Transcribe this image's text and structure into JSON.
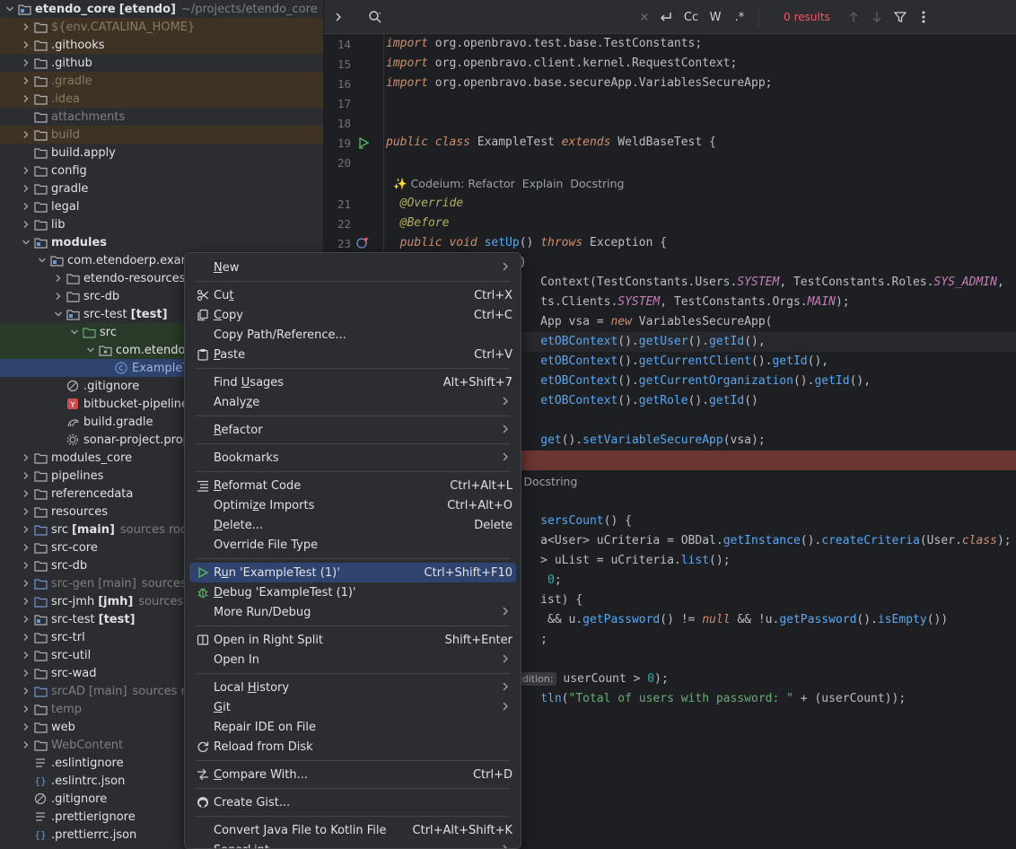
{
  "tree": {
    "items": [
      {
        "name": "etendo_core",
        "suffix": "[etendo]",
        "extra": "~/projects/etendo_core",
        "depth": 0,
        "expanded": true,
        "icon": "module-folder-icon",
        "style": "bold"
      },
      {
        "name": "${env.CATALINA_HOME}",
        "depth": 1,
        "expanded": false,
        "icon": "folder-icon",
        "style": "excl",
        "row": "hl-ex"
      },
      {
        "name": ".githooks",
        "depth": 1,
        "expanded": false,
        "icon": "folder-icon",
        "style": "normal",
        "row": "hl-ex"
      },
      {
        "name": ".github",
        "depth": 1,
        "expanded": false,
        "icon": "folder-icon",
        "style": "normal"
      },
      {
        "name": ".gradle",
        "depth": 1,
        "expanded": false,
        "icon": "folder-icon",
        "style": "excl",
        "row": "hl-ex"
      },
      {
        "name": ".idea",
        "depth": 1,
        "expanded": false,
        "icon": "folder-icon",
        "style": "excl",
        "row": "hl-ex"
      },
      {
        "name": "attachments",
        "depth": 1,
        "leaf": true,
        "icon": "folder-icon",
        "style": "dim"
      },
      {
        "name": "build",
        "depth": 1,
        "expanded": false,
        "icon": "folder-icon",
        "style": "excl",
        "row": "hl-ex"
      },
      {
        "name": "build.apply",
        "depth": 1,
        "leaf": true,
        "icon": "folder-icon",
        "style": "normal"
      },
      {
        "name": "config",
        "depth": 1,
        "expanded": false,
        "icon": "folder-icon",
        "style": "normal"
      },
      {
        "name": "gradle",
        "depth": 1,
        "expanded": false,
        "icon": "folder-icon",
        "style": "normal"
      },
      {
        "name": "legal",
        "depth": 1,
        "expanded": false,
        "icon": "folder-icon",
        "style": "normal"
      },
      {
        "name": "lib",
        "depth": 1,
        "expanded": false,
        "icon": "folder-icon",
        "style": "normal"
      },
      {
        "name": "modules",
        "depth": 1,
        "expanded": true,
        "icon": "module-folder-icon",
        "style": "bold"
      },
      {
        "name": "com.etendoerp.exam",
        "depth": 2,
        "expanded": true,
        "icon": "module-folder-icon",
        "style": "normal"
      },
      {
        "name": "etendo-resources",
        "depth": 3,
        "expanded": false,
        "icon": "folder-icon",
        "style": "normal"
      },
      {
        "name": "src-db",
        "depth": 3,
        "expanded": false,
        "icon": "folder-icon",
        "style": "normal"
      },
      {
        "name": "src-test",
        "suffix": "[test]",
        "depth": 3,
        "expanded": true,
        "icon": "module-folder-icon",
        "style": "normal"
      },
      {
        "name": "src",
        "depth": 4,
        "expanded": true,
        "icon": "test-folder-icon",
        "style": "normal",
        "row": "hl-src"
      },
      {
        "name": "com.etendoe",
        "depth": 5,
        "expanded": true,
        "icon": "package-icon",
        "style": "normal",
        "row": "hl-src"
      },
      {
        "name": "ExampleT",
        "depth": 6,
        "leaf": true,
        "icon": "java-class-icon",
        "style": "cls",
        "row": "sel"
      },
      {
        "name": ".gitignore",
        "depth": 3,
        "leaf": true,
        "icon": "ignore-file-icon",
        "style": "normal"
      },
      {
        "name": "bitbucket-pipeline",
        "depth": 3,
        "leaf": true,
        "icon": "yaml-file-icon",
        "style": "normal"
      },
      {
        "name": "build.gradle",
        "depth": 3,
        "leaf": true,
        "icon": "gradle-file-icon",
        "style": "normal"
      },
      {
        "name": "sonar-project.prop",
        "depth": 3,
        "leaf": true,
        "icon": "settings-file-icon",
        "style": "normal"
      },
      {
        "name": "modules_core",
        "depth": 1,
        "expanded": false,
        "icon": "folder-icon",
        "style": "normal"
      },
      {
        "name": "pipelines",
        "depth": 1,
        "expanded": false,
        "icon": "folder-icon",
        "style": "normal"
      },
      {
        "name": "referencedata",
        "depth": 1,
        "expanded": false,
        "icon": "folder-icon",
        "style": "normal"
      },
      {
        "name": "resources",
        "depth": 1,
        "expanded": false,
        "icon": "folder-icon",
        "style": "normal"
      },
      {
        "name": "src",
        "suffix": "[main]",
        "extra": "sources root",
        "depth": 1,
        "expanded": false,
        "icon": "source-folder-icon",
        "style": "normal"
      },
      {
        "name": "src-core",
        "depth": 1,
        "expanded": false,
        "icon": "folder-icon",
        "style": "normal"
      },
      {
        "name": "src-db",
        "depth": 1,
        "expanded": false,
        "icon": "folder-icon",
        "style": "normal"
      },
      {
        "name": "src-gen",
        "suffix": "[main]",
        "extra": "sources",
        "depth": 1,
        "expanded": false,
        "icon": "source-folder-icon",
        "style": "dim",
        "suffixDim": true
      },
      {
        "name": "src-jmh",
        "suffix": "[jmh]",
        "extra": "sources ro",
        "depth": 1,
        "expanded": false,
        "icon": "source-folder-icon",
        "style": "normal"
      },
      {
        "name": "src-test",
        "suffix": "[test]",
        "depth": 1,
        "expanded": false,
        "icon": "module-folder-icon",
        "style": "normal"
      },
      {
        "name": "src-trl",
        "depth": 1,
        "expanded": false,
        "icon": "folder-icon",
        "style": "normal"
      },
      {
        "name": "src-util",
        "depth": 1,
        "expanded": false,
        "icon": "folder-icon",
        "style": "normal"
      },
      {
        "name": "src-wad",
        "depth": 1,
        "expanded": false,
        "icon": "folder-icon",
        "style": "normal"
      },
      {
        "name": "srcAD",
        "suffix": "[main]",
        "extra": "sources ro",
        "depth": 1,
        "expanded": false,
        "icon": "source-folder-icon",
        "style": "dim",
        "suffixDim": true
      },
      {
        "name": "temp",
        "depth": 1,
        "expanded": false,
        "icon": "folder-icon",
        "style": "dim"
      },
      {
        "name": "web",
        "depth": 1,
        "expanded": false,
        "icon": "folder-icon",
        "style": "normal"
      },
      {
        "name": "WebContent",
        "depth": 1,
        "expanded": false,
        "icon": "folder-icon",
        "style": "dim"
      },
      {
        "name": ".eslintignore",
        "depth": 1,
        "leaf": true,
        "icon": "text-file-icon",
        "style": "normal"
      },
      {
        "name": ".eslintrc.json",
        "depth": 1,
        "leaf": true,
        "icon": "json-file-icon",
        "style": "normal"
      },
      {
        "name": ".gitignore",
        "depth": 1,
        "leaf": true,
        "icon": "ignore-file-icon",
        "style": "normal"
      },
      {
        "name": ".prettierignore",
        "depth": 1,
        "leaf": true,
        "icon": "text-file-icon",
        "style": "normal"
      },
      {
        "name": ".prettierrc.json",
        "depth": 1,
        "leaf": true,
        "icon": "json-file-icon",
        "style": "normal"
      }
    ]
  },
  "search": {
    "expand_icon": "chevron-right-icon",
    "results": "0 results",
    "toggles": [
      "Cc",
      "W",
      ".*"
    ]
  },
  "editor": {
    "lines": [
      {
        "n": "14",
        "html": "<span class=\"kw\">import</span> org.openbravo.test.base.TestConstants;"
      },
      {
        "n": "15",
        "html": "<span class=\"kw\">import</span> org.openbravo.client.kernel.RequestContext;"
      },
      {
        "n": "16",
        "html": "<span class=\"kw\">import</span> org.openbravo.base.secureApp.VariablesSecureApp;"
      },
      {
        "n": "17",
        "html": ""
      },
      {
        "n": "18",
        "html": ""
      },
      {
        "n": "19",
        "html": "<span class=\"kw\">public class</span> ExampleTest <span class=\"kw\">extends</span> WeldBaseTest {",
        "gutter": "run"
      },
      {
        "n": "20",
        "html": ""
      },
      {
        "codeium": "Codeium: Refactor  Explain  Docstring"
      },
      {
        "n": "21",
        "html": "  <span class=\"an\">@Override</span>"
      },
      {
        "n": "22",
        "html": "  <span class=\"an\">@Before</span>"
      },
      {
        "n": "23",
        "html": "  <span class=\"kw\">public void</span> <span class=\"fn\">setUp</span>() <span class=\"kw\">throws</span> Exception {",
        "gutter": "override"
      },
      {
        "n": "",
        "html": "                  ()"
      },
      {
        "n": "",
        "html": "                      Context(TestConstants.Users.<span class=\"cst\">SYSTEM</span>, TestConstants.Roles.<span class=\"cst\">SYS_ADMIN</span>,"
      },
      {
        "n": "",
        "html": "                      ts.Clients.<span class=\"cst\">SYSTEM</span>, TestConstants.Orgs.<span class=\"cst\">MAIN</span>);"
      },
      {
        "n": "",
        "html": "                      App vsa = <span class=\"kw\">new</span> VariablesSecureApp("
      },
      {
        "n": "",
        "html": "                      <span class=\"fn\">etOBContext</span>().<span class=\"fn\">getUser</span>().<span class=\"fn\">getId</span>(),",
        "current": true
      },
      {
        "n": "",
        "html": "                      <span class=\"fn\">etOBContext</span>().<span class=\"fn\">getCurrentClient</span>().<span class=\"fn\">getId</span>(),"
      },
      {
        "n": "",
        "html": "                      <span class=\"fn\">etOBContext</span>().<span class=\"fn\">getCurrentOrganization</span>().<span class=\"fn\">getId</span>(),"
      },
      {
        "n": "",
        "html": "                      <span class=\"fn\">etOBContext</span>().<span class=\"fn\">getRole</span>().<span class=\"fn\">getId</span>()"
      },
      {
        "n": "",
        "html": ""
      },
      {
        "n": "",
        "html": "                      <span class=\"fn\">get</span>().<span class=\"fn\">setVariableSecureApp</span>(vsa);"
      },
      {
        "n": "",
        "html": "",
        "error": true
      },
      {
        "codeium": "                      plain  Docstring"
      },
      {
        "n": "",
        "html": ""
      },
      {
        "n": "",
        "html": "                      <span class=\"fn\">sersCount</span>() {"
      },
      {
        "n": "",
        "html": "                      a&lt;User&gt; uCriteria = OBDal.<span class=\"fn\">getInstance</span>().<span class=\"fn\">createCriteria</span>(User.<span class=\"kw\">class</span>);"
      },
      {
        "n": "",
        "html": "                      &gt; uList = uCriteria.<span class=\"fn\">list</span>();"
      },
      {
        "n": "",
        "html": "                       <span class=\"num\">0</span>;"
      },
      {
        "n": "",
        "html": "                      ist) {"
      },
      {
        "n": "",
        "html": "                       &amp;&amp; u.<span class=\"fn\">getPassword</span>() != <span class=\"kw\">null</span> &amp;&amp; !u.<span class=\"fn\">getPassword</span>().<span class=\"fn\">isEmpty</span>())"
      },
      {
        "n": "",
        "html": "                      ;"
      },
      {
        "n": "",
        "html": ""
      },
      {
        "n": "",
        "html": "                   <span class=\"inlay\">dition:</span> userCount &gt; <span class=\"num\">0</span>);"
      },
      {
        "n": "",
        "html": "                      <span class=\"fn\">tln</span>(<span class=\"st\">\"Total of users with password: \"</span> + (userCount));"
      }
    ]
  },
  "context_menu": {
    "items": [
      {
        "label": "New",
        "mnemonic": "N",
        "submenu": true
      },
      {
        "sep": true
      },
      {
        "label": "Cut",
        "mnemonic": "t",
        "shortcut": "Ctrl+X",
        "icon": "scissors-icon"
      },
      {
        "label": "Copy",
        "mnemonic": "C",
        "shortcut": "Ctrl+C",
        "icon": "copy-icon"
      },
      {
        "label": "Copy Path/Reference...",
        "shortcut": ""
      },
      {
        "label": "Paste",
        "mnemonic": "P",
        "shortcut": "Ctrl+V",
        "icon": "paste-icon"
      },
      {
        "sep": true
      },
      {
        "label": "Find Usages",
        "mnemonic": "U",
        "shortcut": "Alt+Shift+7"
      },
      {
        "label": "Analyze",
        "mnemonic": "z",
        "submenu": true
      },
      {
        "sep": true
      },
      {
        "label": "Refactor",
        "mnemonic": "R",
        "submenu": true
      },
      {
        "sep": true
      },
      {
        "label": "Bookmarks",
        "submenu": true
      },
      {
        "sep": true
      },
      {
        "label": "Reformat Code",
        "mnemonic": "R",
        "shortcut": "Ctrl+Alt+L",
        "icon": "reformat-icon"
      },
      {
        "label": "Optimize Imports",
        "mnemonic": "z",
        "shortcut": "Ctrl+Alt+O"
      },
      {
        "label": "Delete...",
        "mnemonic": "D",
        "shortcut": "Delete"
      },
      {
        "label": "Override File Type"
      },
      {
        "sep": true
      },
      {
        "label": "Run 'ExampleTest (1)'",
        "mnemonic": "u",
        "shortcut": "Ctrl+Shift+F10",
        "icon": "run-icon",
        "active": true
      },
      {
        "label": "Debug 'ExampleTest (1)'",
        "mnemonic": "D",
        "icon": "debug-icon"
      },
      {
        "label": "More Run/Debug",
        "submenu": true
      },
      {
        "sep": true
      },
      {
        "label": "Open in Right Split",
        "shortcut": "Shift+Enter",
        "icon": "split-icon"
      },
      {
        "label": "Open In",
        "submenu": true
      },
      {
        "sep": true
      },
      {
        "label": "Local History",
        "mnemonic": "H",
        "submenu": true
      },
      {
        "label": "Git",
        "mnemonic": "G",
        "submenu": true
      },
      {
        "label": "Repair IDE on File"
      },
      {
        "label": "Reload from Disk",
        "icon": "reload-icon"
      },
      {
        "sep": true
      },
      {
        "label": "Compare With...",
        "mnemonic": "C",
        "shortcut": "Ctrl+D",
        "icon": "compare-icon"
      },
      {
        "sep": true
      },
      {
        "label": "Create Gist...",
        "icon": "github-icon"
      },
      {
        "sep": true
      },
      {
        "label": "Convert Java File to Kotlin File",
        "shortcut": "Ctrl+Alt+Shift+K"
      },
      {
        "label": "SonarLint",
        "submenu": true
      }
    ]
  },
  "colors": {
    "accent_selection": "#2e436e",
    "error_line": "#6b3532",
    "results_red": "#f75464",
    "keyword": "#cf8e6d",
    "function": "#56a8f5"
  }
}
